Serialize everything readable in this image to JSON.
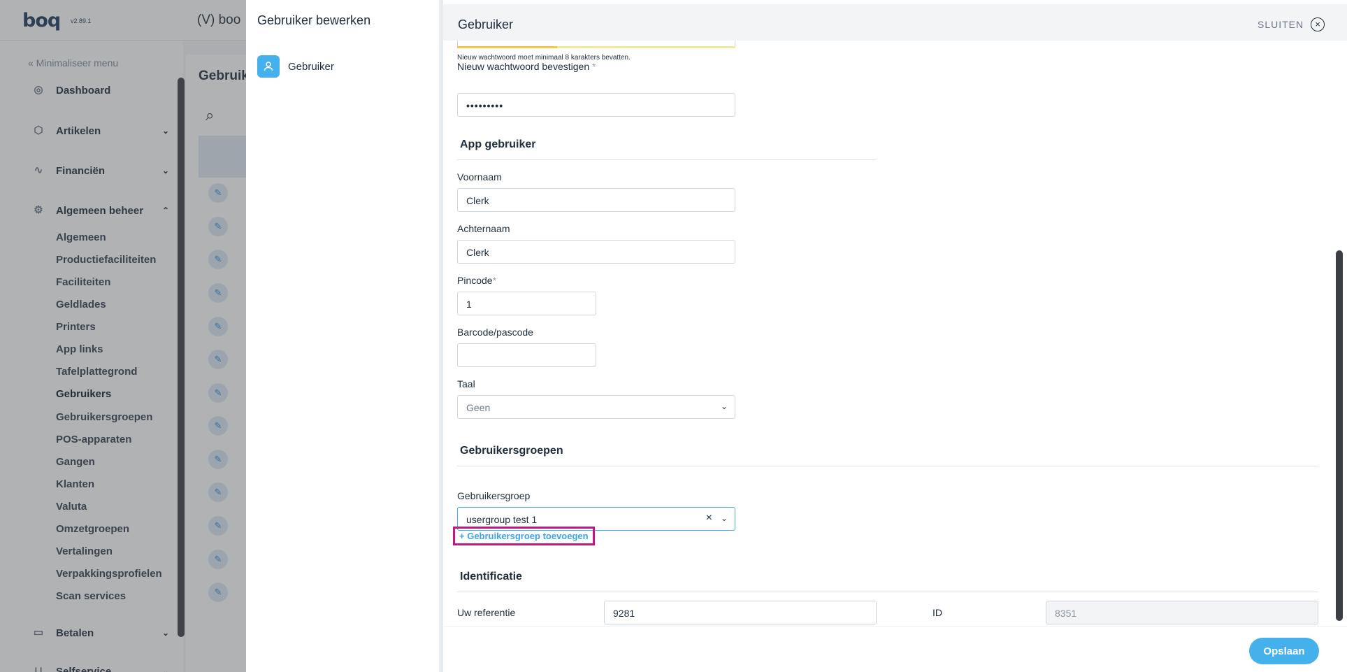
{
  "background_app": {
    "logo": "boq",
    "version": "v2.89.1",
    "venue": "(V) boo",
    "minimize_menu": "« Minimaliseer menu",
    "main_nav": [
      {
        "label": "Dashboard",
        "icon": "dashboard-icon"
      },
      {
        "label": "Artikelen",
        "icon": "box-icon"
      },
      {
        "label": "Financiën",
        "icon": "pulse-icon"
      },
      {
        "label": "Algemeen beheer",
        "icon": "gear-icon"
      },
      {
        "label": "Betalen",
        "icon": "card-icon"
      },
      {
        "label": "Selfservice",
        "icon": "cart-icon"
      }
    ],
    "sub_nav": [
      "Algemeen",
      "Productiefaciliteiten",
      "Faciliteiten",
      "Geldlades",
      "Printers",
      "App links",
      "Tafelplattegrond",
      "Gebruikers",
      "Gebruikersgroepen",
      "POS-apparaten",
      "Gangen",
      "Klanten",
      "Valuta",
      "Omzetgroepen",
      "Vertalingen",
      "Verpakkingsprofielen",
      "Scan services"
    ],
    "active_sub": "Gebruikers",
    "content_title": "Gebruik"
  },
  "drawer": {
    "title": "Gebruiker bewerken",
    "tabs": [
      {
        "label": "Gebruiker",
        "icon": "user-icon"
      }
    ]
  },
  "panel": {
    "title": "Gebruiker",
    "close_label": "SLUITEN",
    "password_hint": "Nieuw wachtwoord moet minimaal 8 karakters bevatten.",
    "password_strength": 0.36,
    "confirm_password": {
      "label": "Nieuw wachtwoord bevestigen",
      "required": "*",
      "value": "•••••••••"
    },
    "app_user_section": "App gebruiker",
    "first_name": {
      "label": "Voornaam",
      "value": "Clerk"
    },
    "last_name": {
      "label": "Achternaam",
      "value": "Clerk"
    },
    "pincode": {
      "label": "Pincode",
      "required": "*",
      "value": "1"
    },
    "barcode": {
      "label": "Barcode/pascode",
      "value": ""
    },
    "language": {
      "label": "Taal",
      "value": "Geen"
    },
    "usergroups_section": "Gebruikersgroepen",
    "usergroup": {
      "label": "Gebruikersgroep",
      "value": "usergroup test 1"
    },
    "add_usergroup_link": "+ Gebruikersgroep toevoegen",
    "identification_section": "Identificatie",
    "reference": {
      "label": "Uw referentie",
      "value": "9281"
    },
    "id_field": {
      "label": "ID",
      "value": "8351"
    },
    "save_label": "Opslaan"
  },
  "colors": {
    "accent": "#45b1ec",
    "highlight": "#c2177e",
    "link": "#3aa5e8"
  }
}
